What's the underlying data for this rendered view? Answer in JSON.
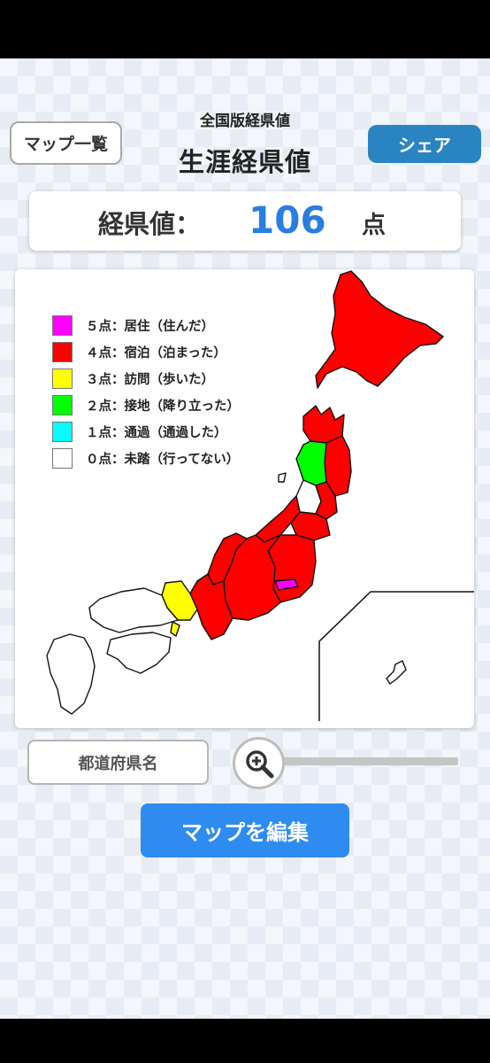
{
  "header": {
    "map_list_label": "マップ一覧",
    "subtitle": "全国版経県値",
    "title": "生涯経県値",
    "share_label": "シェア"
  },
  "score": {
    "label": "経県値：",
    "value": "106",
    "unit": "点"
  },
  "legend": [
    {
      "text": "５点：居住（住んだ）",
      "color": "#ff00ff"
    },
    {
      "text": "４点：宿泊（泊まった）",
      "color": "#ff0000"
    },
    {
      "text": "３点：訪問（歩いた）",
      "color": "#ffff00"
    },
    {
      "text": "２点：接地（降り立った）",
      "color": "#00ff00"
    },
    {
      "text": "１点：通過（通過した）",
      "color": "#00ffff"
    },
    {
      "text": "０点：未踏（行ってない）",
      "color": "#ffffff"
    }
  ],
  "controls": {
    "prefecture_name_label": "都道府県名",
    "zoom_icon": "zoom-in-icon",
    "edit_map_label": "マップを編集"
  }
}
